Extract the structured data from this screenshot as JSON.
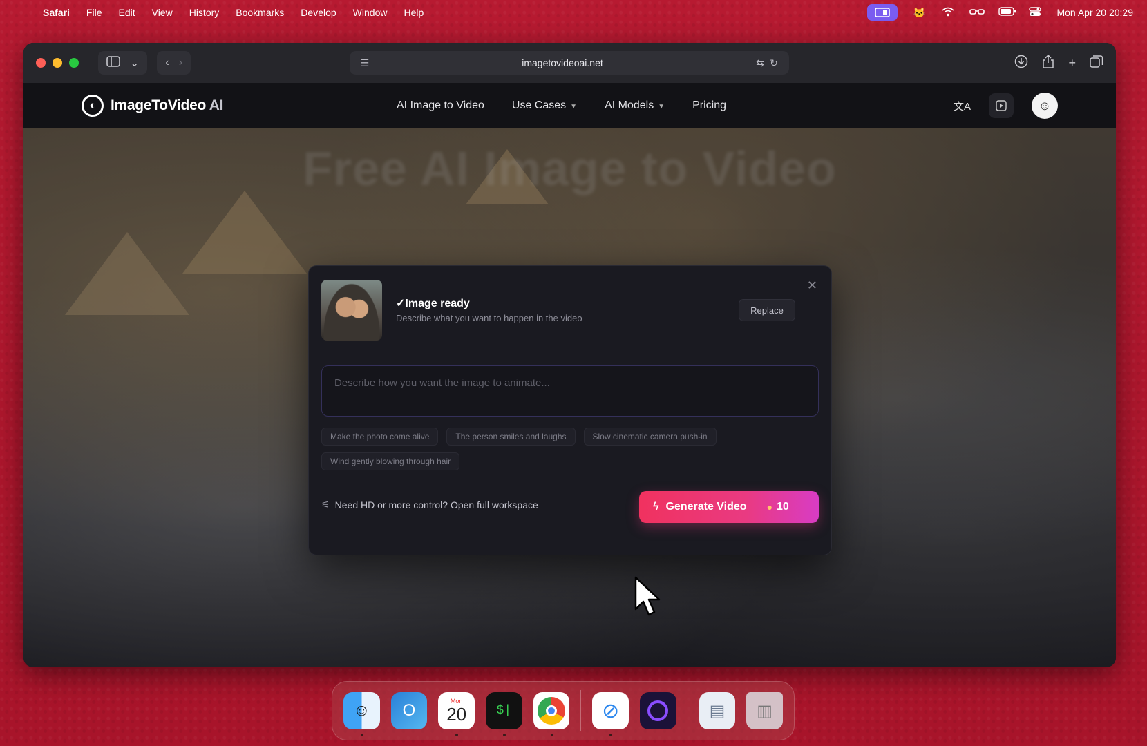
{
  "menubar": {
    "app": "Safari",
    "items": [
      "File",
      "Edit",
      "View",
      "History",
      "Bookmarks",
      "Develop",
      "Window",
      "Help"
    ],
    "clock": "Mon Apr 20  20:29"
  },
  "browser": {
    "url": "imagetovideoai.net"
  },
  "site": {
    "logo_text": "ImageToVideo",
    "logo_suffix": "AI",
    "nav": [
      "AI Image to Video",
      "Use Cases",
      "AI Models",
      "Pricing"
    ],
    "hero_title": "Free AI Image to Video"
  },
  "modal": {
    "ready_title": "✓Image ready",
    "ready_subtitle": "Describe what you want to happen in the video",
    "replace_label": "Replace",
    "prompt_placeholder": "Describe how you want the image to animate...",
    "chips": [
      "Make the photo come alive",
      "The person smiles and laughs",
      "Slow cinematic camera push-in",
      "Wind gently blowing through hair"
    ],
    "workspace_link": "Need HD or more control? Open full workspace",
    "generate_label": "Generate Video",
    "credits": "10"
  },
  "dock": {
    "calendar_month": "Mon",
    "calendar_day": "20",
    "terminal_glyph": "$|"
  },
  "colors": {
    "accent_gradient_start": "#f0325f",
    "accent_gradient_end": "#d83cc4",
    "desktop": "#b3192e"
  }
}
